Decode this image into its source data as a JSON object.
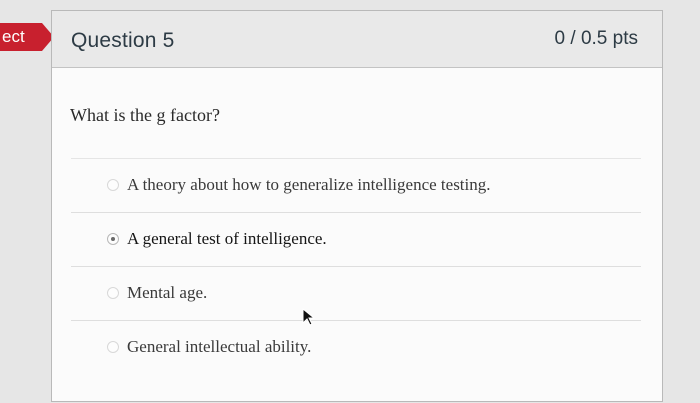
{
  "incorrect_tag": "ect",
  "question": {
    "title": "Question 5",
    "points": "0 / 0.5 pts",
    "prompt": "What is the g factor?",
    "answers": [
      {
        "label": "A theory about how to generalize intelligence testing.",
        "selected": false
      },
      {
        "label": "A general test of intelligence.",
        "selected": true
      },
      {
        "label": "Mental age.",
        "selected": false
      },
      {
        "label": "General intellectual ability.",
        "selected": false
      }
    ]
  },
  "colors": {
    "incorrect_tag": "#c8202e",
    "header_bg": "#e9e9e9",
    "card_bg": "#fbfbfb",
    "page_bg": "#e6e6e6"
  },
  "icons": {
    "cursor": "mouse-pointer-icon"
  }
}
